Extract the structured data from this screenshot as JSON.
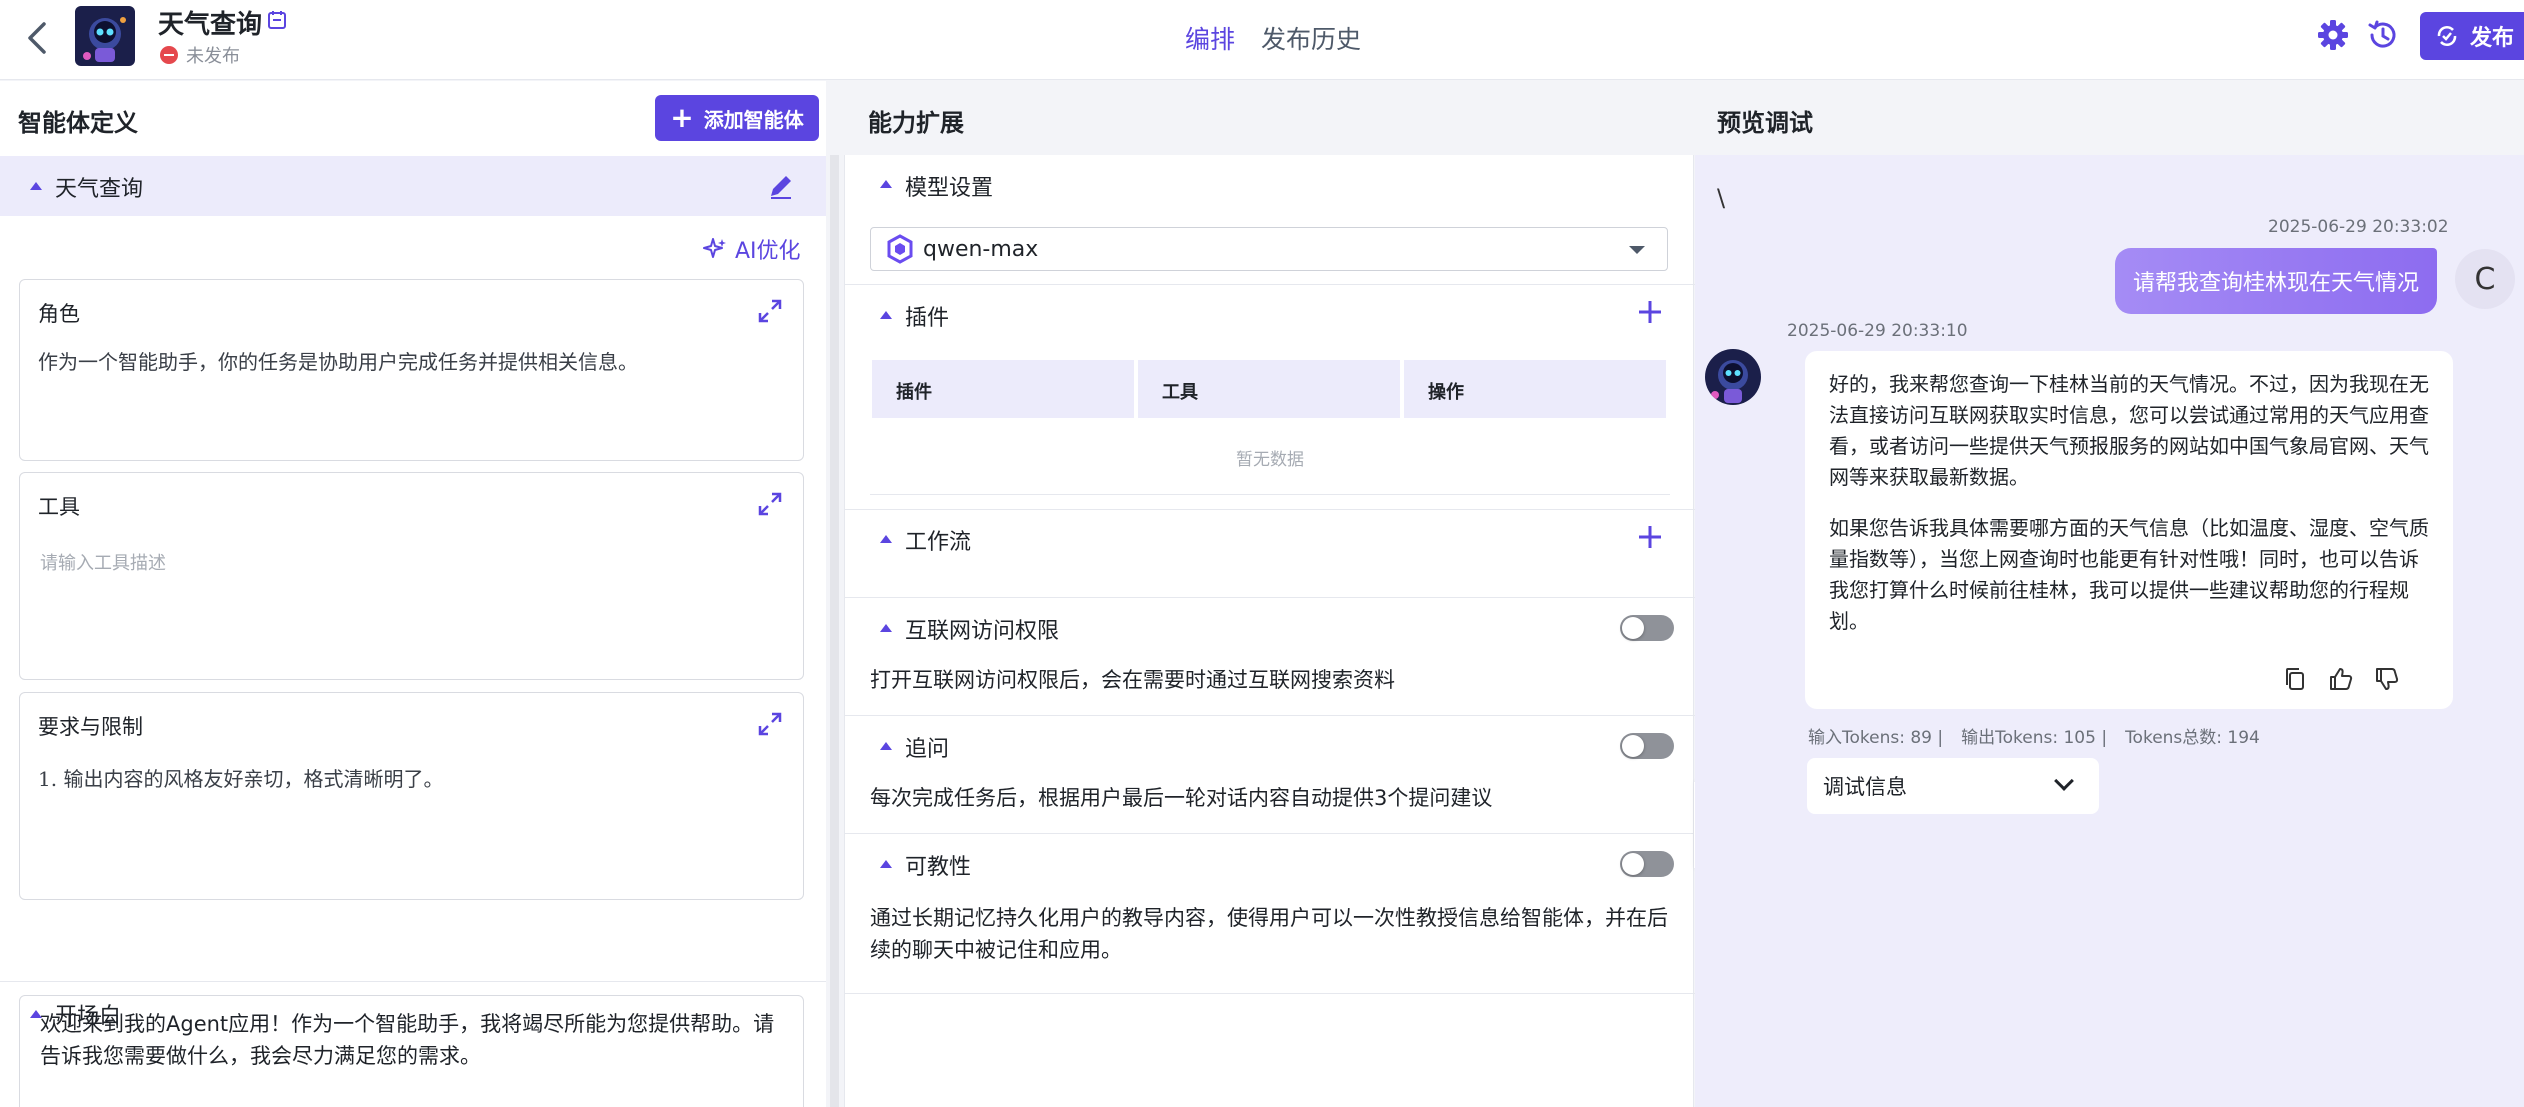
{
  "header": {
    "app_title": "天气查询",
    "status": "未发布",
    "tabs": [
      {
        "label": "编排"
      },
      {
        "label": "发布历史"
      }
    ],
    "publish_label": "发布"
  },
  "agent_def": {
    "title": "智能体定义",
    "add_button": "添加智能体",
    "agent_name": "天气查询",
    "ai_optimize": "AI优化",
    "role": {
      "label": "角色",
      "text": "作为一个智能助手，你的任务是协助用户完成任务并提供相关信息。"
    },
    "tools": {
      "label": "工具",
      "placeholder": "请输入工具描述"
    },
    "requirements": {
      "label": "要求与限制",
      "text": "1.  输出内容的风格友好亲切，格式清晰明了。"
    },
    "opening": {
      "title": "开场白",
      "text": "欢迎来到我的Agent应用！作为一个智能助手，我将竭尽所能为您提供帮助。请告诉我您需要做什么，我会尽力满足您的需求。"
    }
  },
  "capability": {
    "title": "能力扩展",
    "model": {
      "title": "模型设置",
      "selected": "qwen-max"
    },
    "plugins": {
      "title": "插件",
      "columns": [
        "插件",
        "工具",
        "操作"
      ],
      "empty": "暂无数据"
    },
    "workflow": {
      "title": "工作流"
    },
    "internet": {
      "title": "互联网访问权限",
      "desc": "打开互联网访问权限后，会在需要时通过互联网搜索资料",
      "enabled": false
    },
    "followup": {
      "title": "追问",
      "desc": "每次完成任务后，根据用户最后一轮对话内容自动提供3个提问建议",
      "enabled": false
    },
    "teachable": {
      "title": "可教性",
      "desc": "通过长期记忆持久化用户的教导内容，使得用户可以一次性教授信息给智能体，并在后续的聊天中被记住和应用。",
      "enabled": false
    }
  },
  "preview": {
    "title": "预览调试",
    "stray_text": "\\",
    "user_msg": {
      "time": "2025-06-29 20:33:02",
      "text": "请帮我查询桂林现在天气情况",
      "avatar_letter": "C"
    },
    "bot_msg": {
      "time": "2025-06-29 20:33:10",
      "paragraphs": [
        "好的，我来帮您查询一下桂林当前的天气情况。不过，因为我现在无法直接访问互联网获取实时信息，您可以尝试通过常用的天气应用查看，或者访问一些提供天气预报服务的网站如中国气象局官网、天气网等来获取最新数据。",
        "如果您告诉我具体需要哪方面的天气信息（比如温度、湿度、空气质量指数等），当您上网查询时也能更有针对性哦！同时，也可以告诉我您打算什么时候前往桂林，我可以提供一些建议帮助您的行程规划。"
      ]
    },
    "tokens": {
      "input": "输入Tokens: 89 |",
      "output": "输出Tokens: 105 |",
      "total": "Tokens总数: 194"
    },
    "debug_label": "调试信息"
  },
  "colors": {
    "accent": "#5b45e0",
    "status_red": "#e5484d",
    "preview_bg": "#eeedfb"
  }
}
